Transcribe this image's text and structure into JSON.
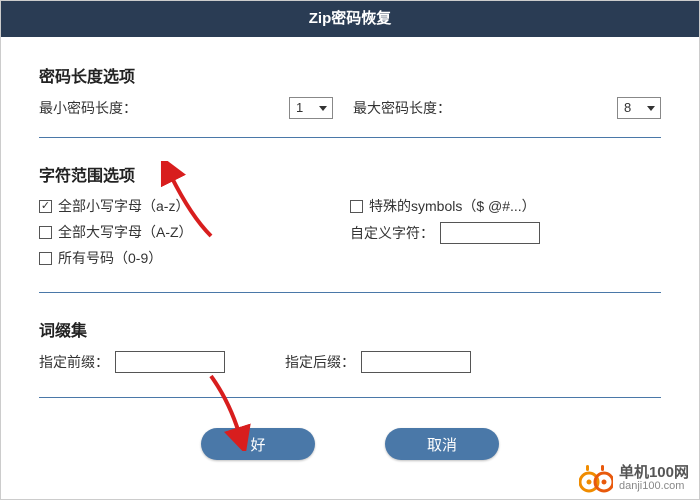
{
  "title": "Zip密码恢复",
  "length": {
    "section": "密码长度选项",
    "min_label": "最小密码长度：",
    "min_value": "1",
    "max_label": "最大密码长度：",
    "max_value": "8"
  },
  "charset": {
    "section": "字符范围选项",
    "lowercase": {
      "label": "全部小写字母（a-z）",
      "checked": true
    },
    "uppercase": {
      "label": "全部大写字母（A-Z）",
      "checked": false
    },
    "digits": {
      "label": "所有号码（0-9）",
      "checked": false
    },
    "symbols": {
      "label": "特殊的symbols（$ @#...）",
      "checked": false
    },
    "custom_label": "自定义字符：",
    "custom_value": ""
  },
  "affix": {
    "section": "词缀集",
    "prefix_label": "指定前缀：",
    "prefix_value": "",
    "suffix_label": "指定后缀：",
    "suffix_value": ""
  },
  "buttons": {
    "ok": "好",
    "cancel": "取消"
  },
  "watermark": {
    "name": "单机100网",
    "url": "danji100.com"
  }
}
